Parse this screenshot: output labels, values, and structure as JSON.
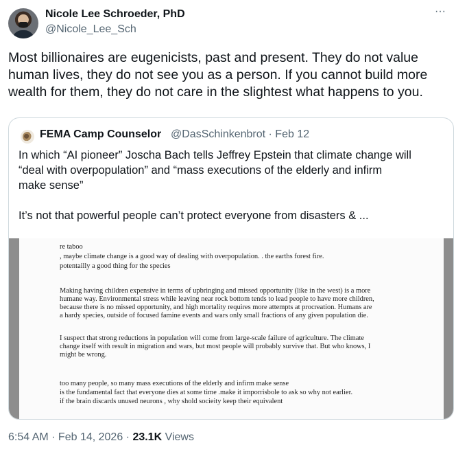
{
  "author": {
    "name": "Nicole Lee Schroeder, PhD",
    "handle": "@Nicole_Lee_Sch"
  },
  "more_label": "···",
  "tweet": {
    "lines": [
      "Most billionaires are eugenicists, past and present. They do not value",
      "human lives, they do not see you as a person. If you cannot build more",
      "wealth for them, they do not care in the slightest what happens to you."
    ]
  },
  "quote": {
    "name": "FEMA Camp Counselor",
    "handle_date": "@DasSchinkenbrot · Feb 12",
    "lines": [
      "In which “AI pioneer” Joscha Bach tells Jeffrey Epstein that climate change will",
      "“deal with overpopulation” and “mass executions of the elderly and infirm",
      "make sense”"
    ],
    "line2": "It’s not that powerful people can’t protect everyone from disasters & ...",
    "document_lines": [
      "re taboo",
      "    , maybe climate change is a good way of dealing with overpopulation.    . the earths forest fire.",
      "potentailly a good thing for the species",
      "Making having children expensive in terms of upbringing and missed opportunity (like in the west) is a more",
      "humane way. Environmental stress while leaving near rock bottom tends to lead people to have more children,",
      "because there is no missed opportunity, and high mortality requires more attempts at procreation. Humans are",
      "a hardy species, outside of focused famine events and wars only small fractions of any given population die.",
      "I suspect that strong reductions in population will come from large-scale failure of agriculture. The climate",
      "change itself with result in migration and wars, but most people will probably survive that. But who knows, I",
      "might be wrong.",
      "too many people,    so many mass executions of the elderly and infirm    make sense",
      "is the fundamental  fact that everyone dies at some time .make it imporrisbole to ask so why not  earlier.",
      "if the brain discards unused neurons ,  why shold socieity keep their equivalent"
    ]
  },
  "meta": {
    "time_date": "6:54 AM · Feb 14, 2026 · ",
    "views_count": "23.1K",
    "views_label": " Views"
  }
}
